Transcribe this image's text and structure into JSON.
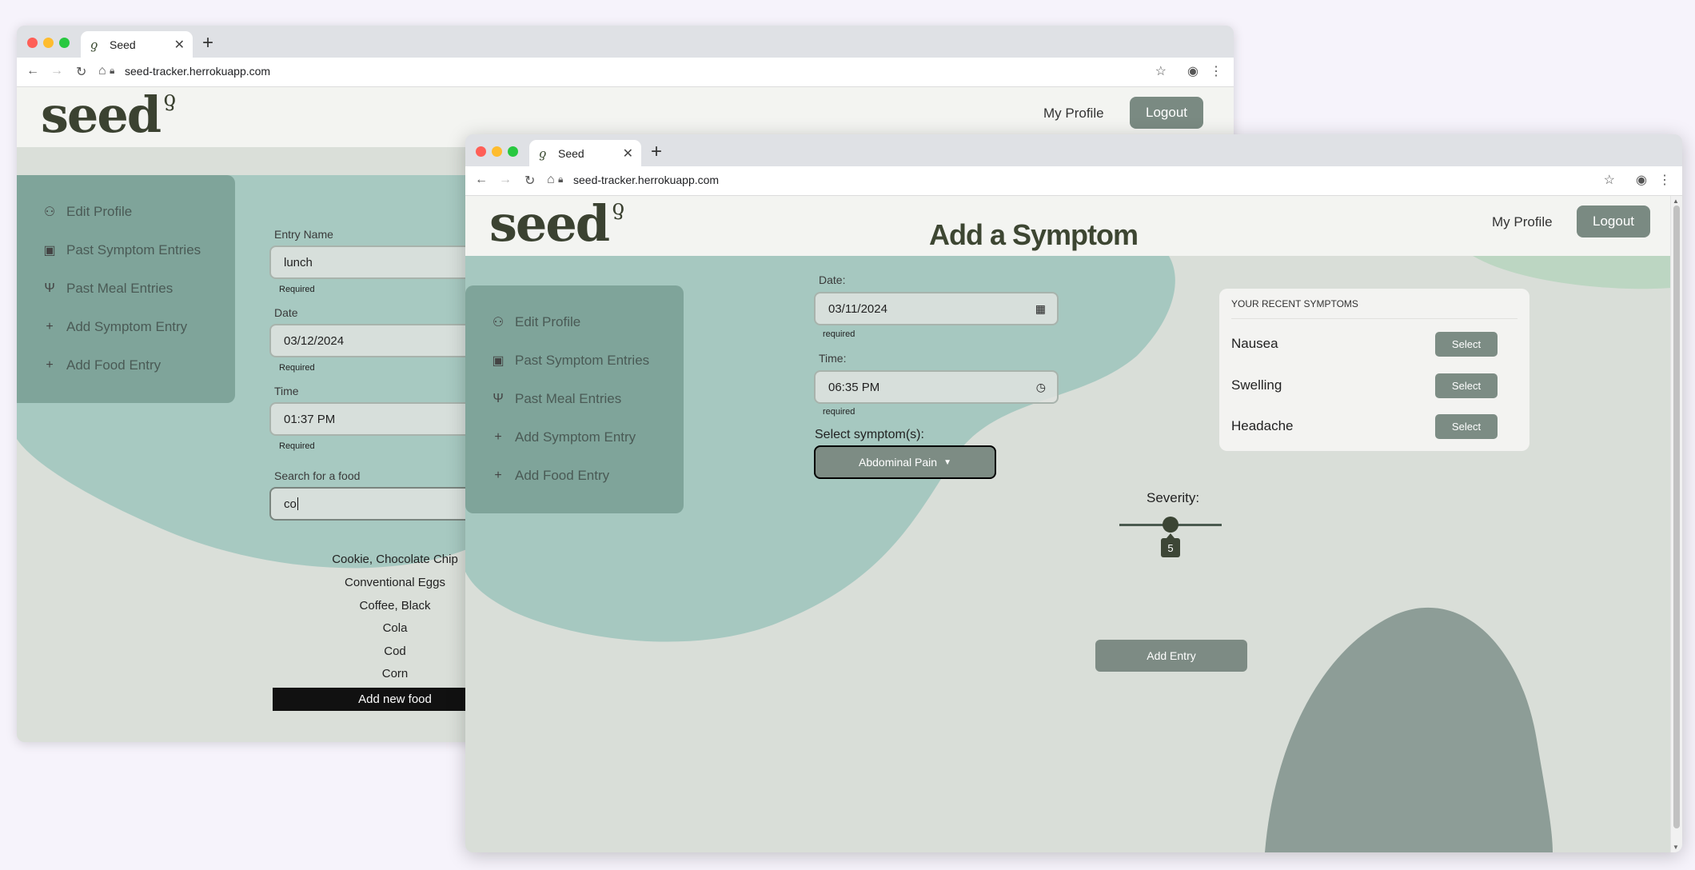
{
  "colors": {
    "sidebar": "#70968a",
    "button": "#7d8b84",
    "teal_blob": "#a5c9c0",
    "dark_text": "#3d4632"
  },
  "browser": {
    "tab_title": "Seed",
    "url": "seed-tracker.herrokuapp.com",
    "favicon_icon": "sprout-icon"
  },
  "app": {
    "logo": "seed",
    "my_profile": "My Profile",
    "logout": "Logout"
  },
  "sidebar": {
    "items": [
      {
        "label": "Edit Profile",
        "icon": "person-icon"
      },
      {
        "label": "Past Symptom Entries",
        "icon": "clipboard-icon"
      },
      {
        "label": "Past Meal Entries",
        "icon": "fork-knife-icon"
      },
      {
        "label": "Add Symptom Entry",
        "icon": "plus-icon"
      },
      {
        "label": "Add Food Entry",
        "icon": "plus-icon"
      }
    ]
  },
  "food_form": {
    "entry_name_label": "Entry Name",
    "entry_name_value": "lunch",
    "date_label": "Date",
    "date_value": "03/12/2024",
    "time_label": "Time",
    "time_value": "01:37 PM",
    "required": "Required",
    "search_label": "Search for a food",
    "search_value": "co",
    "results": [
      "Cookie, Chocolate Chip",
      "Conventional Eggs",
      "Coffee, Black",
      "Cola",
      "Cod",
      "Corn"
    ],
    "add_new": "Add new food"
  },
  "symptom_form": {
    "title": "Add a Symptom",
    "date_label": "Date:",
    "date_value": "03/11/2024",
    "time_label": "Time:",
    "time_value": "06:35 PM",
    "required": "required",
    "select_label": "Select symptom(s):",
    "selected_symptom": "Abdominal Pain",
    "severity_label": "Severity:",
    "severity_value": 5,
    "severity_max": 10,
    "add_entry": "Add Entry"
  },
  "recent": {
    "header": "YOUR RECENT SYMPTOMS",
    "select_label": "Select",
    "items": [
      "Nausea",
      "Swelling",
      "Headache"
    ]
  }
}
